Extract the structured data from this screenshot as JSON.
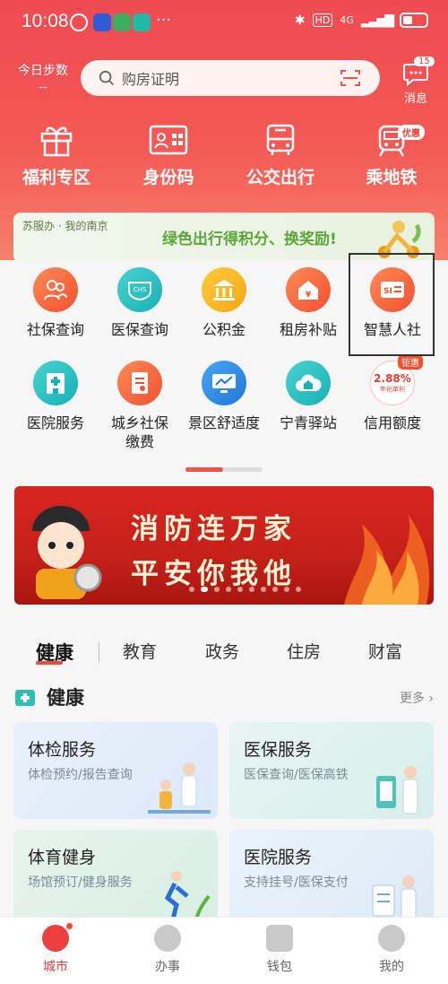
{
  "status_bar": {
    "time": "10:08",
    "network": "4G",
    "hd": "HD"
  },
  "header": {
    "steps_label": "今日步数",
    "steps_value": "--",
    "search_placeholder": "购房证明",
    "messages_label": "消息",
    "messages_badge": "15"
  },
  "quick_actions": [
    {
      "label": "福利专区",
      "icon": "gift-icon"
    },
    {
      "label": "身份码",
      "icon": "id-card-icon"
    },
    {
      "label": "公交出行",
      "icon": "bus-icon"
    },
    {
      "label": "乘地铁",
      "icon": "metro-icon",
      "badge": "优惠"
    }
  ],
  "promo": {
    "tag": "苏服办 · 我的南京",
    "slogan": "绿色出行得积分、换奖励!"
  },
  "services": [
    {
      "label": "社保查询",
      "icon": "people-icon",
      "color": "orange"
    },
    {
      "label": "医保查询",
      "icon": "chs-icon",
      "color": "teal"
    },
    {
      "label": "公积金",
      "icon": "bank-icon",
      "color": "gold"
    },
    {
      "label": "租房补贴",
      "icon": "house-icon",
      "color": "orange"
    },
    {
      "label": "智慧人社",
      "icon": "si-card-icon",
      "color": "orange"
    },
    {
      "label": "医院服务",
      "icon": "hospital-icon",
      "color": "teal"
    },
    {
      "label": "城乡社保\n缴费",
      "icon": "document-icon",
      "color": "orange"
    },
    {
      "label": "景区舒适度",
      "icon": "monitor-icon",
      "color": "blue"
    },
    {
      "label": "宁青驿站",
      "icon": "cloud-home-icon",
      "color": "teal"
    },
    {
      "label": "信用额度",
      "icon": "rate-badge-icon",
      "color": "white",
      "badge_top": "钜惠",
      "rate": "2.88%",
      "rate_sub": "年化单利"
    }
  ],
  "banner": {
    "line1": "消防连万家",
    "line2": "平安你我他"
  },
  "category_tabs": [
    "健康",
    "教育",
    "政务",
    "住房",
    "财富"
  ],
  "section": {
    "title": "健康",
    "more": "更多"
  },
  "cards": [
    {
      "title": "体检服务",
      "subtitle": "体检预约/报告查询"
    },
    {
      "title": "医保服务",
      "subtitle": "医保查询/医保高铁"
    },
    {
      "title": "体育健身",
      "subtitle": "场馆预订/健身服务"
    },
    {
      "title": "医院服务",
      "subtitle": "支持挂号/医保支付"
    }
  ],
  "tabbar": [
    {
      "label": "城市",
      "active": true
    },
    {
      "label": "办事"
    },
    {
      "label": "钱包"
    },
    {
      "label": "我的"
    }
  ],
  "colors": {
    "brand_red": "#ef4a52",
    "accent_orange": "#f25131",
    "teal": "#17b1b6",
    "green_slogan": "#5aa63a"
  }
}
